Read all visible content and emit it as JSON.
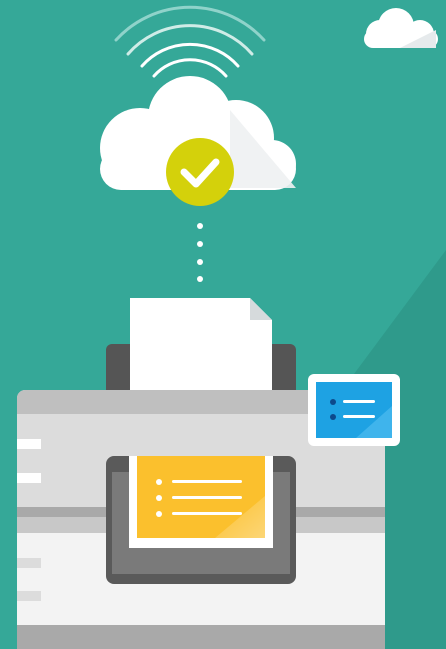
{
  "illustration": {
    "subject": "cloud-printing",
    "icons": [
      "wifi-signal-icon",
      "cloud-icon",
      "checkmark-icon",
      "small-cloud-icon",
      "document-icon",
      "printer-icon",
      "printer-display-icon",
      "printed-list-icon"
    ]
  },
  "colors": {
    "background": "#35a898",
    "background_shade": "#2f9a8b",
    "cloud": "#ffffff",
    "cloud_shade": "#e6eaec",
    "check_badge": "#d4d10b",
    "printer_body": "#dcdcdc",
    "printer_dark": "#5a5a5a",
    "printed_page": "#fbc02d",
    "display": "#1ea2e3"
  }
}
